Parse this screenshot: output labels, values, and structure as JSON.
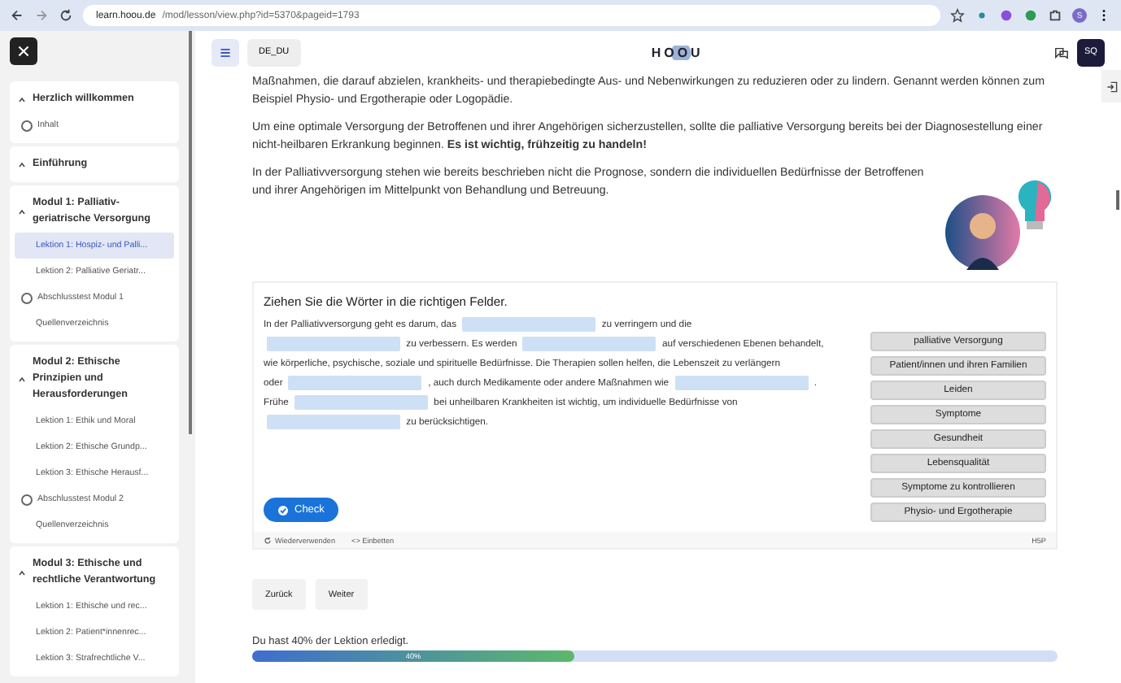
{
  "browser": {
    "url_host": "learn.hoou.de",
    "url_path": "/mod/lesson/view.php?id=5370&pageid=1793",
    "profile": "S"
  },
  "header": {
    "language": "DE_DU",
    "logo": "HOOU",
    "user": "SQ"
  },
  "sidebar": {
    "sections": [
      {
        "title": "Herzlich willkommen",
        "expanded": true,
        "items": [
          {
            "label": "Inhalt",
            "kind": "test",
            "selected": false
          }
        ]
      },
      {
        "title": "Einführung",
        "expanded": true
      },
      {
        "title": "Modul 1: Palliativ-geriatrische Versorgung",
        "expanded": true,
        "items": [
          {
            "label": "Lektion 1: Hospiz- und Palli...",
            "kind": "page",
            "selected": true
          },
          {
            "label": "Lektion 2: Palliative Geriatr...",
            "kind": "page",
            "selected": false
          },
          {
            "label": "Abschlusstest Modul 1",
            "kind": "test",
            "selected": false
          },
          {
            "label": "Quellenverzeichnis",
            "kind": "page",
            "selected": false
          }
        ]
      },
      {
        "title": "Modul 2: Ethische Prinzipien und Herausforderungen",
        "expanded": true,
        "items": [
          {
            "label": "Lektion 1: Ethik und Moral",
            "kind": "page",
            "selected": false
          },
          {
            "label": "Lektion 2: Ethische Grundp...",
            "kind": "page",
            "selected": false
          },
          {
            "label": "Lektion 3: Ethische Herausf...",
            "kind": "page",
            "selected": false
          },
          {
            "label": "Abschlusstest Modul 2",
            "kind": "test",
            "selected": false
          },
          {
            "label": "Quellenverzeichnis",
            "kind": "page",
            "selected": false
          }
        ]
      },
      {
        "title": "Modul 3: Ethische und rechtliche Verantwortung",
        "expanded": true,
        "items": [
          {
            "label": "Lektion 1: Ethische und rec...",
            "kind": "page",
            "selected": false
          },
          {
            "label": "Lektion 2: Patient*innenrec...",
            "kind": "page",
            "selected": false
          },
          {
            "label": "Lektion 3: Strafrechtliche V...",
            "kind": "page",
            "selected": false
          }
        ]
      }
    ]
  },
  "content": {
    "paragraphs": [
      "Maßnahmen, die darauf abzielen, krankheits- und therapiebedingte Aus- und Nebenwirkungen zu reduzieren oder zu lindern. Genannt werden können zum Beispiel Physio- und Ergotherapie oder Logopädie.",
      "Um eine optimale Versorgung der Betroffenen und ihrer Angehörigen sicherzustellen, sollte die palliative Versorgung bereits bei der Diagnosestellung einer nicht-heilbaren Erkrankung beginnen. **Es ist wichtig, frühzeitig zu handeln!**",
      "In der Palliativversorgung stehen wie bereits beschrieben nicht die Prognose, sondern die individuellen Bedürfnisse der Betroffenen und ihrer Angehörigen im Mittelpunkt von Behandlung und Betreuung."
    ]
  },
  "quiz": {
    "title": "Ziehen Sie die Wörter in die richtigen Felder.",
    "segments": [
      {
        "kind": "text",
        "text": "In der Palliativversorgung geht es darum, das"
      },
      {
        "kind": "blank"
      },
      {
        "kind": "text",
        "text": "zu verringern und die"
      },
      {
        "kind": "break"
      },
      {
        "kind": "blank"
      },
      {
        "kind": "text",
        "text": "zu verbessern. Es werden"
      },
      {
        "kind": "blank"
      },
      {
        "kind": "text",
        "text": "auf verschiedenen Ebenen behandelt,"
      },
      {
        "kind": "break"
      },
      {
        "kind": "text",
        "text": "wie körperliche, psychische, soziale und spirituelle Bedürfnisse. Die Therapien sollen helfen, die Lebenszeit zu verlängern"
      },
      {
        "kind": "break"
      },
      {
        "kind": "text",
        "text": "oder"
      },
      {
        "kind": "blank"
      },
      {
        "kind": "text",
        "text": ", auch durch Medikamente oder andere Maßnahmen wie"
      },
      {
        "kind": "blank"
      },
      {
        "kind": "text",
        "text": "."
      },
      {
        "kind": "break"
      },
      {
        "kind": "text",
        "text": "Frühe"
      },
      {
        "kind": "blank"
      },
      {
        "kind": "text",
        "text": "bei unheilbaren Krankheiten ist wichtig, um individuelle Bedürfnisse von"
      },
      {
        "kind": "break"
      },
      {
        "kind": "blank"
      },
      {
        "kind": "text",
        "text": "zu berücksichtigen."
      }
    ],
    "words": [
      "palliative Versorgung",
      "Patient/innen und ihren Familien",
      "Leiden",
      "Symptome",
      "Gesundheit",
      "Lebensqualität",
      "Symptome zu kontrollieren",
      "Physio- und Ergotherapie"
    ],
    "check": "Check",
    "reuse": "Wiederverwenden",
    "embed": "<> Einbetten",
    "brand": "H5P"
  },
  "nav": {
    "back": "Zurück",
    "next": "Weiter"
  },
  "progress": {
    "text": "Du hast 40% der Lektion erledigt.",
    "level": 0.4,
    "label": "40%"
  }
}
